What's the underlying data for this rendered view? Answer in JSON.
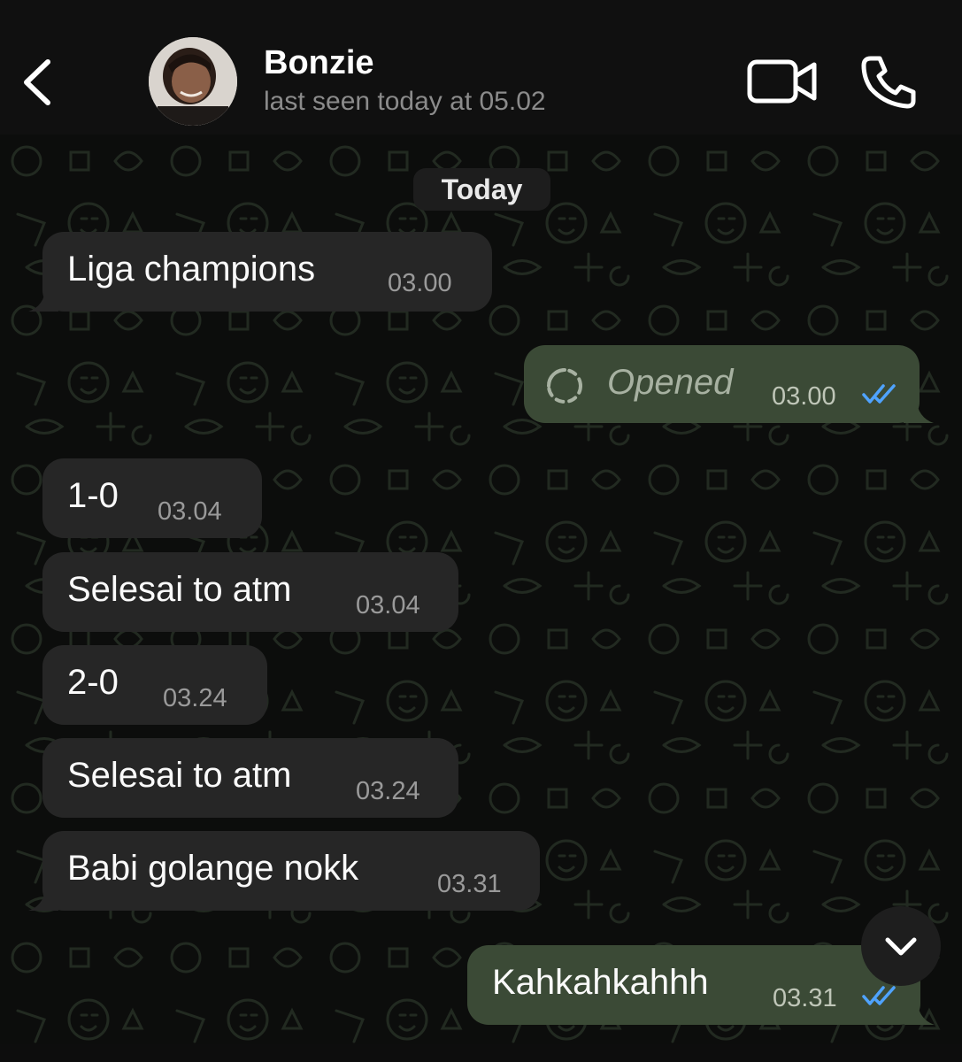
{
  "header": {
    "contact_name": "Bonzie",
    "last_seen": "last seen today at 05.02",
    "icons": {
      "back": "chevron-left-icon",
      "video": "video-camera-icon",
      "call": "phone-icon"
    }
  },
  "chat": {
    "date_separator": "Today",
    "messages": [
      {
        "direction": "incoming",
        "text": "Liga champions",
        "time": "03.00"
      },
      {
        "direction": "outgoing",
        "text": "Opened",
        "time": "03.00",
        "status": "read",
        "type": "view-once-opened"
      },
      {
        "direction": "incoming",
        "text": "1-0",
        "time": "03.04"
      },
      {
        "direction": "incoming",
        "text": "Selesai to atm",
        "time": "03.04"
      },
      {
        "direction": "incoming",
        "text": "2-0",
        "time": "03.24"
      },
      {
        "direction": "incoming",
        "text": "Selesai to atm",
        "time": "03.24"
      },
      {
        "direction": "incoming",
        "text": "Babi golange nokk",
        "time": "03.31"
      },
      {
        "direction": "outgoing",
        "text": "Kahkahkahhh",
        "time": "03.31",
        "status": "read"
      }
    ]
  },
  "colors": {
    "incoming_bubble": "#262626",
    "outgoing_bubble": "#3b4a36",
    "read_tick": "#4fa3ff"
  }
}
